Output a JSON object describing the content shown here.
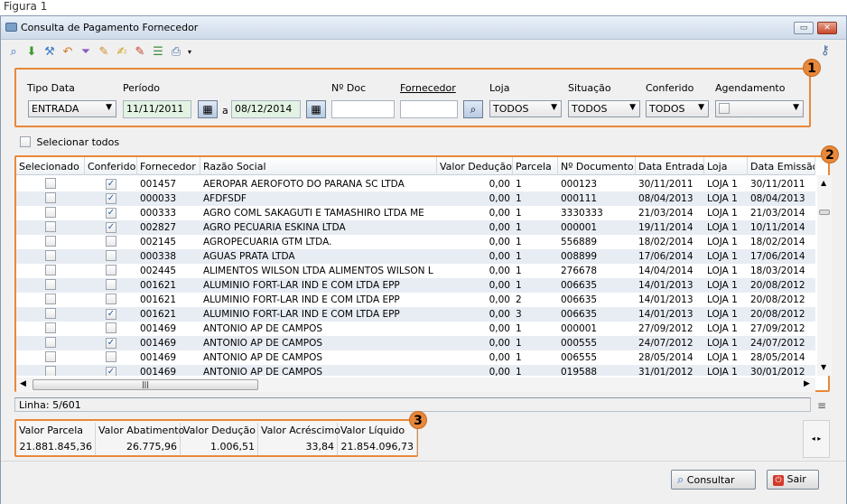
{
  "figure_caption": "Figura 1",
  "window": {
    "title": "Consulta de Pagamento Fornecedor"
  },
  "toolbar": {
    "icons": [
      "search-icon",
      "arrow-down-icon",
      "tools-icon",
      "undo-icon",
      "filter-icon",
      "edit-icon",
      "edit-note-icon",
      "edit-red-icon",
      "stack-icon",
      "print-icon",
      "dropdown-icon"
    ],
    "key_icon": "key-icon"
  },
  "filters": {
    "tipo_data": {
      "label": "Tipo Data",
      "value": "ENTRADA"
    },
    "periodo": {
      "label": "Período",
      "start": "11/11/2011",
      "sep": "a",
      "end": "08/12/2014"
    },
    "n_doc": {
      "label": "Nº Doc",
      "value": ""
    },
    "fornecedor": {
      "label": "Fornecedor",
      "value": ""
    },
    "loja": {
      "label": "Loja",
      "value": "TODOS"
    },
    "situacao": {
      "label": "Situação",
      "value": "TODOS"
    },
    "conferido": {
      "label": "Conferido",
      "value": "TODOS"
    },
    "agendamento": {
      "label": "Agendamento",
      "value": ""
    }
  },
  "select_all": {
    "label": "Selecionar todos"
  },
  "badges": [
    "1",
    "2",
    "3"
  ],
  "grid": {
    "columns": [
      "Selecionado",
      "Conferido",
      "Fornecedor",
      "Razão Social",
      "Valor Dedução",
      "Parcela",
      "Nº Documento",
      "Data Entrada",
      "Loja",
      "Data Emissão"
    ],
    "rows": [
      {
        "sel": false,
        "conf": true,
        "forn": "001457",
        "razao": "AEROPAR AEROFOTO DO PARANA SC LTDA",
        "ded": "0,00",
        "parc": "1",
        "doc": "000123",
        "entrada": "30/11/2011",
        "loja": "LOJA 1",
        "emissao": "30/11/2011"
      },
      {
        "sel": false,
        "conf": true,
        "forn": "000033",
        "razao": "AFDFSDF",
        "ded": "0,00",
        "parc": "1",
        "doc": "000111",
        "entrada": "08/04/2013",
        "loja": "LOJA 1",
        "emissao": "08/04/2013"
      },
      {
        "sel": false,
        "conf": true,
        "forn": "000333",
        "razao": "AGRO COML SAKAGUTI E TAMASHIRO LTDA ME",
        "ded": "0,00",
        "parc": "1",
        "doc": "3330333",
        "entrada": "21/03/2014",
        "loja": "LOJA 1",
        "emissao": "21/03/2014"
      },
      {
        "sel": false,
        "conf": true,
        "forn": "002827",
        "razao": "AGRO PECUARIA ESKINA LTDA",
        "ded": "0,00",
        "parc": "1",
        "doc": "000001",
        "entrada": "19/11/2014",
        "loja": "LOJA 1",
        "emissao": "10/11/2014"
      },
      {
        "sel": false,
        "conf": false,
        "forn": "002145",
        "razao": "AGROPECUARIA GTM LTDA.",
        "ded": "0,00",
        "parc": "1",
        "doc": "556889",
        "entrada": "18/02/2014",
        "loja": "LOJA 1",
        "emissao": "18/02/2014"
      },
      {
        "sel": false,
        "conf": false,
        "forn": "000338",
        "razao": "AGUAS PRATA LTDA",
        "ded": "0,00",
        "parc": "1",
        "doc": "008899",
        "entrada": "17/06/2014",
        "loja": "LOJA 1",
        "emissao": "17/06/2014"
      },
      {
        "sel": false,
        "conf": false,
        "forn": "002445",
        "razao": "ALIMENTOS WILSON LTDA ALIMENTOS WILSON L",
        "ded": "0,00",
        "parc": "1",
        "doc": "276678",
        "entrada": "14/04/2014",
        "loja": "LOJA 1",
        "emissao": "18/03/2014"
      },
      {
        "sel": false,
        "conf": false,
        "forn": "001621",
        "razao": "ALUMINIO FORT-LAR IND E COM LTDA EPP",
        "ded": "0,00",
        "parc": "1",
        "doc": "006635",
        "entrada": "14/01/2013",
        "loja": "LOJA 1",
        "emissao": "20/08/2012"
      },
      {
        "sel": false,
        "conf": false,
        "forn": "001621",
        "razao": "ALUMINIO FORT-LAR IND E COM LTDA EPP",
        "ded": "0,00",
        "parc": "2",
        "doc": "006635",
        "entrada": "14/01/2013",
        "loja": "LOJA 1",
        "emissao": "20/08/2012"
      },
      {
        "sel": false,
        "conf": true,
        "forn": "001621",
        "razao": "ALUMINIO FORT-LAR IND E COM LTDA EPP",
        "ded": "0,00",
        "parc": "3",
        "doc": "006635",
        "entrada": "14/01/2013",
        "loja": "LOJA 1",
        "emissao": "20/08/2012"
      },
      {
        "sel": false,
        "conf": false,
        "forn": "001469",
        "razao": "ANTONIO AP DE CAMPOS",
        "ded": "0,00",
        "parc": "1",
        "doc": "000001",
        "entrada": "27/09/2012",
        "loja": "LOJA 1",
        "emissao": "27/09/2012"
      },
      {
        "sel": false,
        "conf": true,
        "forn": "001469",
        "razao": "ANTONIO AP DE CAMPOS",
        "ded": "0,00",
        "parc": "1",
        "doc": "000555",
        "entrada": "24/07/2012",
        "loja": "LOJA 1",
        "emissao": "24/07/2012"
      },
      {
        "sel": false,
        "conf": false,
        "forn": "001469",
        "razao": "ANTONIO AP DE CAMPOS",
        "ded": "0,00",
        "parc": "1",
        "doc": "006555",
        "entrada": "28/05/2014",
        "loja": "LOJA 1",
        "emissao": "28/05/2014"
      },
      {
        "sel": false,
        "conf": true,
        "forn": "001469",
        "razao": "ANTONIO AP DE CAMPOS",
        "ded": "0,00",
        "parc": "1",
        "doc": "019588",
        "entrada": "31/01/2012",
        "loja": "LOJA 1",
        "emissao": "30/01/2012"
      }
    ]
  },
  "status": {
    "linha": "Linha: 5/601"
  },
  "totals": {
    "headers": [
      "Valor Parcela",
      "Valor Abatimento",
      "Valor Dedução",
      "Valor Acréscimo",
      "Valor Líquido"
    ],
    "values": [
      "21.881.845,36",
      "26.775,96",
      "1.006,51",
      "33,84",
      "21.854.096,73"
    ]
  },
  "buttons": {
    "consultar": "Consultar",
    "sair": "Sair"
  },
  "colors": {
    "highlight": "#e8883a",
    "row_alt": "#e8edf4",
    "date_field": "#e3f3e3"
  }
}
